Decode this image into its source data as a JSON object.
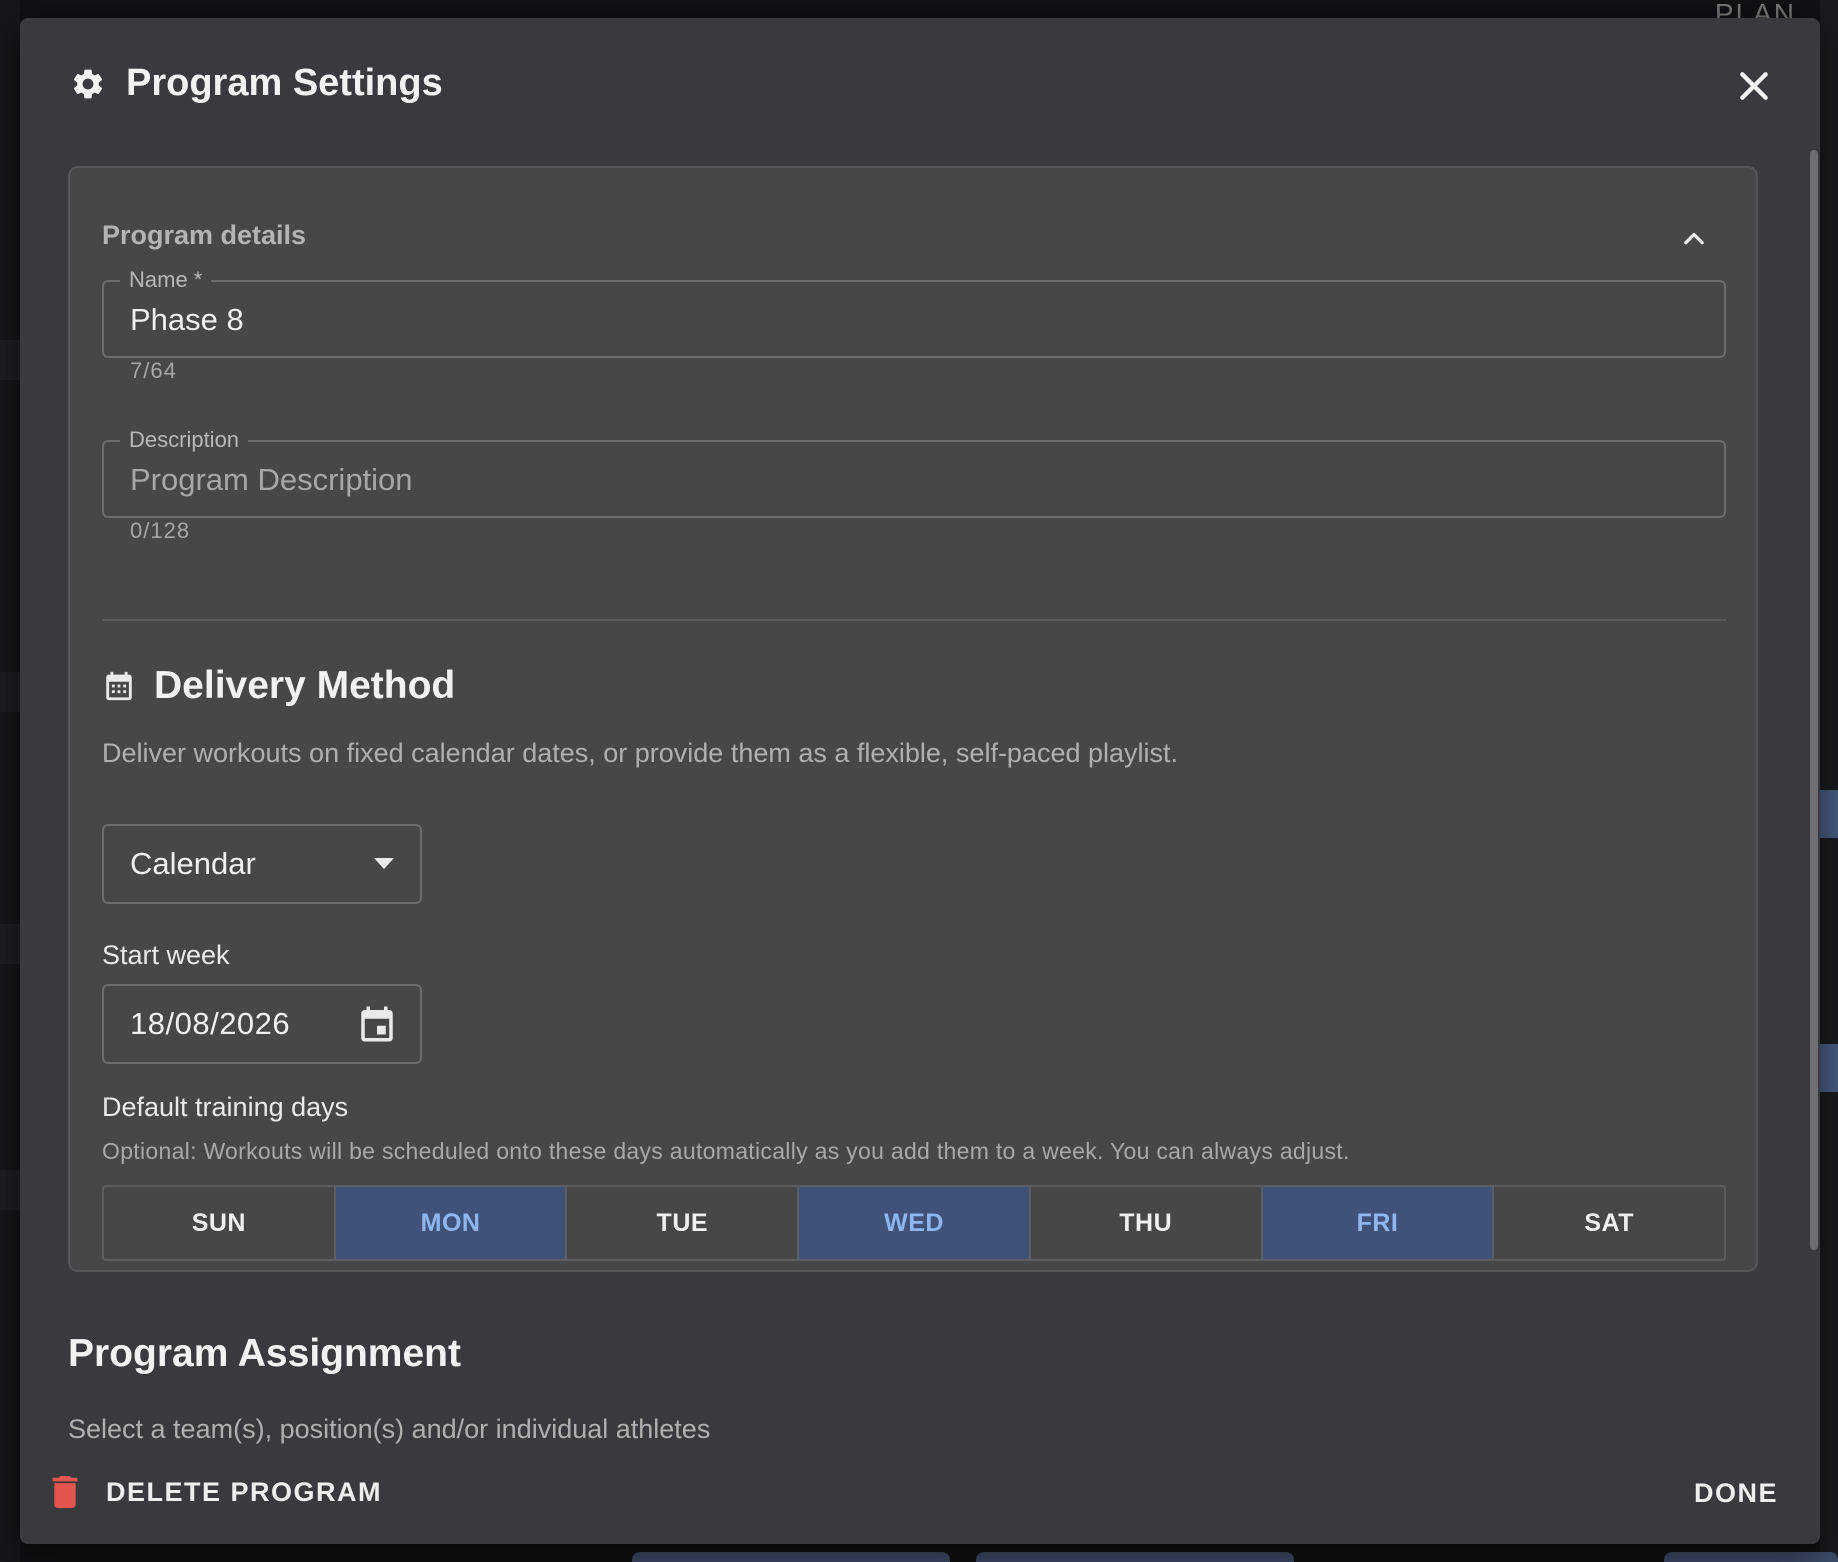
{
  "background": {
    "top_right_text": "PLAN"
  },
  "modal": {
    "title": "Program Settings",
    "title_icon": "gear-icon",
    "close_icon": "close-icon"
  },
  "program_details": {
    "heading": "Program details",
    "name": {
      "label": "Name *",
      "value": "Phase 8",
      "counter": "7/64"
    },
    "description": {
      "label": "Description",
      "placeholder": "Program Description",
      "value": "",
      "counter": "0/128"
    }
  },
  "delivery": {
    "heading": "Delivery Method",
    "description": "Deliver workouts on fixed calendar dates, or provide them as a flexible, self-paced playlist.",
    "method_selected": "Calendar",
    "start_week_label": "Start week",
    "start_week_value": "18/08/2026",
    "default_days_label": "Default training days",
    "default_days_hint": "Optional: Workouts will be scheduled onto these days automatically as you add them to a week. You can always adjust.",
    "days": [
      {
        "label": "SUN",
        "selected": false
      },
      {
        "label": "MON",
        "selected": true
      },
      {
        "label": "TUE",
        "selected": false
      },
      {
        "label": "WED",
        "selected": true
      },
      {
        "label": "THU",
        "selected": false
      },
      {
        "label": "FRI",
        "selected": true
      },
      {
        "label": "SAT",
        "selected": false
      }
    ]
  },
  "assignment": {
    "heading": "Program Assignment",
    "description": "Select a team(s), position(s) and/or individual athletes"
  },
  "footer": {
    "delete_label": "DELETE PROGRAM",
    "done_label": "DONE"
  },
  "colors": {
    "modal_bg": "#393a3d",
    "card_bg": "#464749",
    "day_selected_bg": "#41527a",
    "day_selected_text": "#8fb6ef",
    "delete_icon": "#e5554f"
  }
}
